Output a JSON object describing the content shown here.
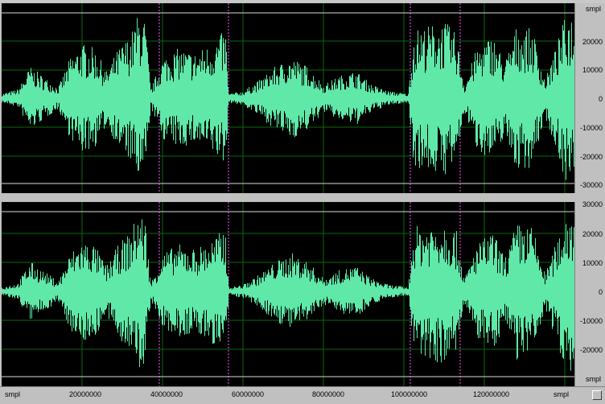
{
  "colors": {
    "waveform": "#5fe8a8",
    "background": "#000000",
    "grid": "#0a6a0a",
    "selection_marker": "#ff50ff",
    "boundary": "#d8d8d8"
  },
  "amplitude_scale": {
    "unit": "smpl",
    "top_channel_labels": [
      "20000",
      "10000",
      "0",
      "-10000",
      "-20000",
      "-30000"
    ],
    "bottom_channel_labels": [
      "30000",
      "20000",
      "10000",
      "0",
      "-10000",
      "-20000"
    ],
    "bottom_unit": "smpl"
  },
  "time_ruler": {
    "unit": "smpl",
    "labels": [
      "20000000",
      "40000000",
      "60000000",
      "80000000",
      "100000000",
      "120000000",
      "smpl"
    ]
  }
}
